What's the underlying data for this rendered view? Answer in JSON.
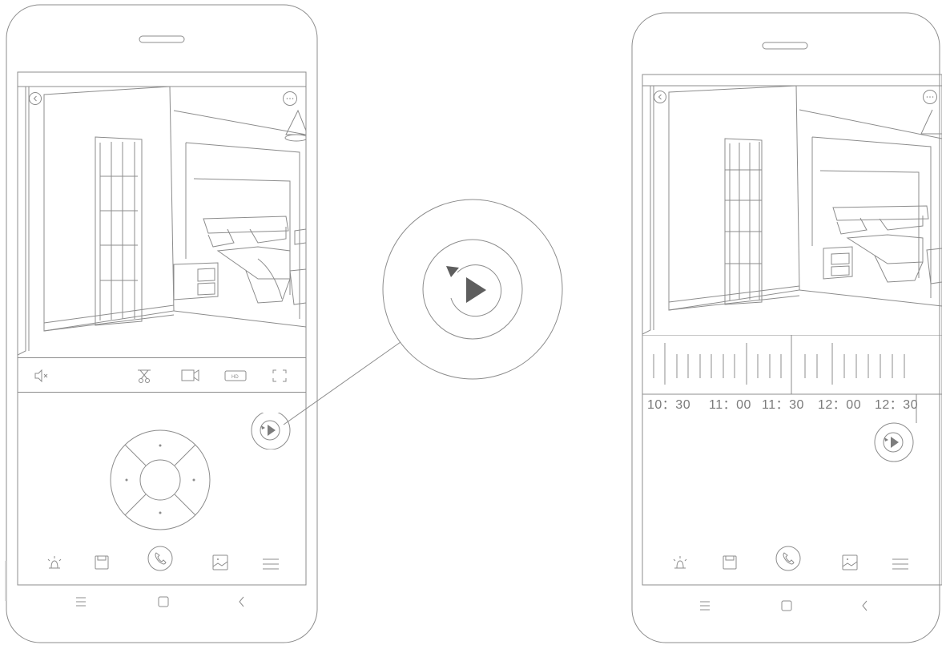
{
  "phone_left": {
    "camera_controls": [
      {
        "icon": "mute-icon"
      },
      {
        "icon": "scissors-icon"
      },
      {
        "icon": "video-record-icon"
      },
      {
        "icon": "hd-icon",
        "label": "HD"
      },
      {
        "icon": "fullscreen-icon"
      }
    ],
    "direction_pad": {
      "icon": "direction-pad"
    },
    "playback_button": {
      "icon": "playback-icon"
    },
    "bottom_toolbar": [
      {
        "icon": "alarm-icon"
      },
      {
        "icon": "save-icon"
      },
      {
        "icon": "phone-call-icon"
      },
      {
        "icon": "gallery-icon"
      },
      {
        "icon": "menu-icon"
      }
    ],
    "system_nav": [
      {
        "icon": "menu-icon"
      },
      {
        "icon": "home-icon"
      },
      {
        "icon": "back-icon"
      }
    ]
  },
  "zoom_callout": {
    "icon": "playback-icon"
  },
  "phone_right": {
    "timeline": {
      "labels": [
        "10：30",
        "11：00",
        "11：30",
        "12：00",
        "12：30"
      ]
    },
    "playback_button": {
      "icon": "playback-icon"
    },
    "bottom_toolbar": [
      {
        "icon": "alarm-icon"
      },
      {
        "icon": "save-icon"
      },
      {
        "icon": "phone-call-icon"
      },
      {
        "icon": "gallery-icon"
      },
      {
        "icon": "menu-icon"
      }
    ],
    "system_nav": [
      {
        "icon": "menu-icon"
      },
      {
        "icon": "home-icon"
      },
      {
        "icon": "back-icon"
      }
    ]
  }
}
